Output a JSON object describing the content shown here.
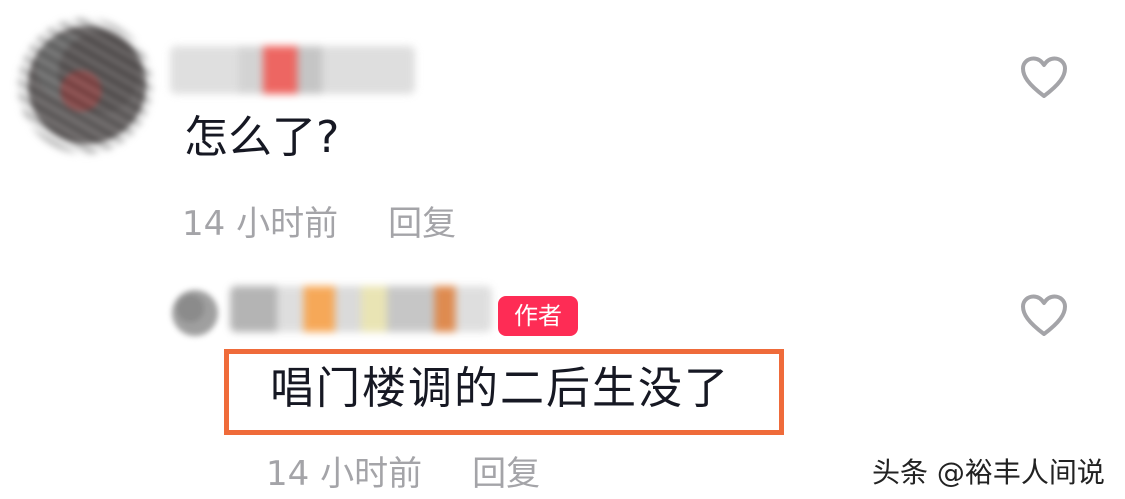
{
  "comments": [
    {
      "text": "怎么了?",
      "time": "14 小时前",
      "reply": "回复",
      "like_icon": "heart-outline-icon"
    },
    {
      "badge": "作者",
      "text": "唱门楼调的二后生没了",
      "time": "14 小时前",
      "reply": "回复",
      "like_icon": "heart-outline-icon",
      "highlight_color": "#ef6b3a"
    }
  ],
  "watermark": "头条 @裕丰人间说",
  "colors": {
    "text": "#161823",
    "meta": "#a4a4a8",
    "badge": "#fe2c55"
  }
}
